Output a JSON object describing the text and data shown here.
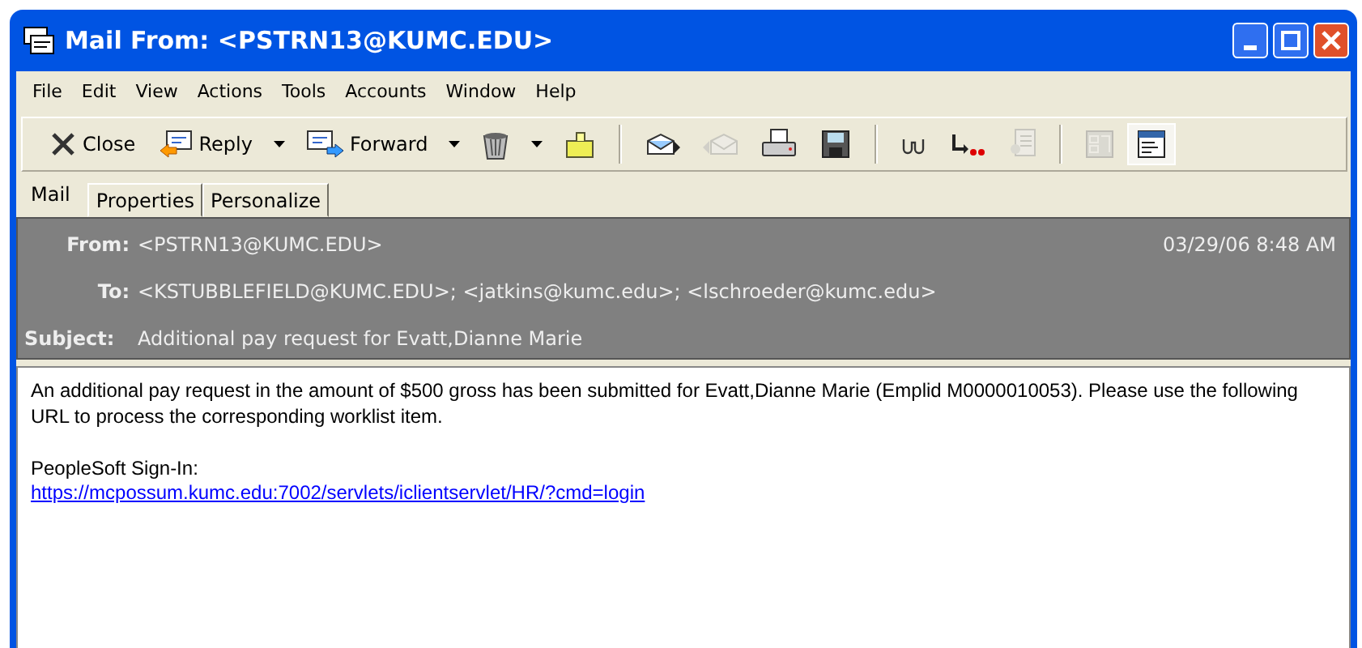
{
  "window": {
    "title": "Mail From: <PSTRN13@KUMC.EDU>"
  },
  "menu": [
    "File",
    "Edit",
    "View",
    "Actions",
    "Tools",
    "Accounts",
    "Window",
    "Help"
  ],
  "toolbar": [
    {
      "kind": "button",
      "label": "Close",
      "dropdown": false,
      "disabled": false,
      "pressed": false
    },
    {
      "kind": "button",
      "label": "Reply",
      "dropdown": true,
      "disabled": false,
      "pressed": false
    },
    {
      "kind": "button",
      "label": "Forward",
      "dropdown": true,
      "disabled": false,
      "pressed": false
    },
    {
      "kind": "button",
      "dropdown": true,
      "disabled": false,
      "pressed": false
    },
    {
      "kind": "button",
      "dropdown": false,
      "disabled": false,
      "pressed": false
    },
    {
      "kind": "separator"
    },
    {
      "kind": "button",
      "dropdown": false,
      "disabled": false,
      "pressed": false
    },
    {
      "kind": "button",
      "dropdown": false,
      "disabled": true,
      "pressed": false
    },
    {
      "kind": "button",
      "dropdown": false,
      "disabled": false,
      "pressed": false
    },
    {
      "kind": "button",
      "dropdown": false,
      "disabled": false,
      "pressed": false
    },
    {
      "kind": "separator"
    },
    {
      "kind": "button",
      "dropdown": false,
      "disabled": false,
      "pressed": false
    },
    {
      "kind": "button",
      "dropdown": false,
      "disabled": false,
      "pressed": false
    },
    {
      "kind": "button",
      "dropdown": false,
      "disabled": true,
      "pressed": false
    },
    {
      "kind": "separator"
    },
    {
      "kind": "button",
      "dropdown": false,
      "disabled": true,
      "pressed": false
    },
    {
      "kind": "button",
      "dropdown": false,
      "disabled": false,
      "pressed": true
    }
  ],
  "tabs": [
    {
      "label": "Mail",
      "selected": true
    },
    {
      "label": "Properties",
      "selected": false
    },
    {
      "label": "Personalize",
      "selected": false
    }
  ],
  "header": {
    "from_label": "From:",
    "from": "<PSTRN13@KUMC.EDU>",
    "date": "03/29/06 8:48 AM",
    "to_label": "To:",
    "to": "<KSTUBBLEFIELD@KUMC.EDU>; <jatkins@kumc.edu>; <lschroeder@kumc.edu>",
    "subject_label": "Subject:",
    "subject": "Additional pay request for Evatt,Dianne Marie"
  },
  "body": {
    "paragraph": "An additional pay request in the amount of $500 gross has been submitted for Evatt,Dianne Marie (Emplid M0000010053). Please use the following URL to process the corresponding worklist item.",
    "signin_label": "PeopleSoft Sign-In:",
    "link": "https://mcpossum.kumc.edu:7002/servlets/iclientservlet/HR/?cmd=login"
  }
}
